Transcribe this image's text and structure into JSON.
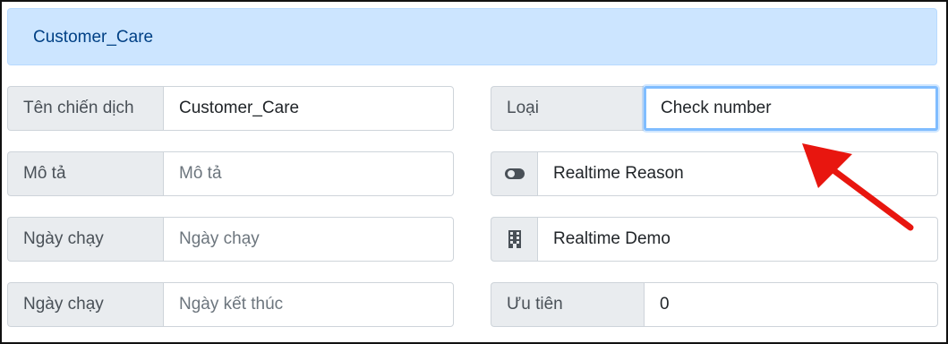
{
  "header": {
    "title": "Customer_Care"
  },
  "left": {
    "campaign_name": {
      "label": "Tên chiến dịch",
      "value": "Customer_Care"
    },
    "description": {
      "label": "Mô tả",
      "placeholder": "Mô tả"
    },
    "start_date": {
      "label": "Ngày chạy",
      "placeholder": "Ngày chạy"
    },
    "end_date": {
      "label": "Ngày chạy",
      "placeholder": "Ngày kết thúc"
    }
  },
  "right": {
    "type": {
      "label": "Loại",
      "value": "Check number"
    },
    "reason": {
      "icon": "toggle-icon",
      "value": "Realtime Reason"
    },
    "company": {
      "icon": "building-icon",
      "value": "Realtime Demo"
    },
    "priority": {
      "label": "Ưu tiên",
      "value": "0"
    }
  },
  "colors": {
    "header_bg": "#cce5ff",
    "header_text": "#004085",
    "addon_bg": "#e9ecef",
    "focus_border": "#80bdff",
    "annotation_arrow": "#e8160f"
  }
}
